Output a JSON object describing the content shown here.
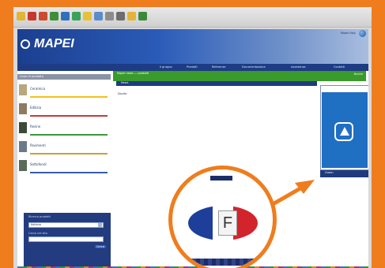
{
  "header": {
    "logo_text": "MAPEI",
    "util_text": "Mapei Italy"
  },
  "nav": {
    "items": [
      "Il gruppo",
      "Prodotti",
      "Referenze",
      "Documentazione",
      "Assistenza",
      "Contatti"
    ]
  },
  "sidebar": {
    "heading": "Linee di prodotto",
    "items": [
      {
        "label": "Ceramica",
        "color": "#f2c21b"
      },
      {
        "label": "Edilizia",
        "color": "#c83a3a"
      },
      {
        "label": "Resine",
        "color": "#3a9a3a"
      },
      {
        "label": "Pavimenti",
        "color": "#c8a23a"
      },
      {
        "label": "Sottofondi",
        "color": "#3a5aa8"
      }
    ],
    "search": {
      "title": "Ricerca prodotti",
      "select_value": "Italiano",
      "label": "Cerca nel sito",
      "button": "Cerca"
    }
  },
  "main": {
    "green_text": "Mapei news — prodotti",
    "green_links": "Novita",
    "blue_bar": "News",
    "news_title": "Novita",
    "promo_footer": "Green"
  },
  "loupe": {
    "flag_letter": "F"
  },
  "colors": {
    "accent": "#ef7d1e",
    "brand_blue": "#1d3c85",
    "green": "#3a9a2c"
  }
}
